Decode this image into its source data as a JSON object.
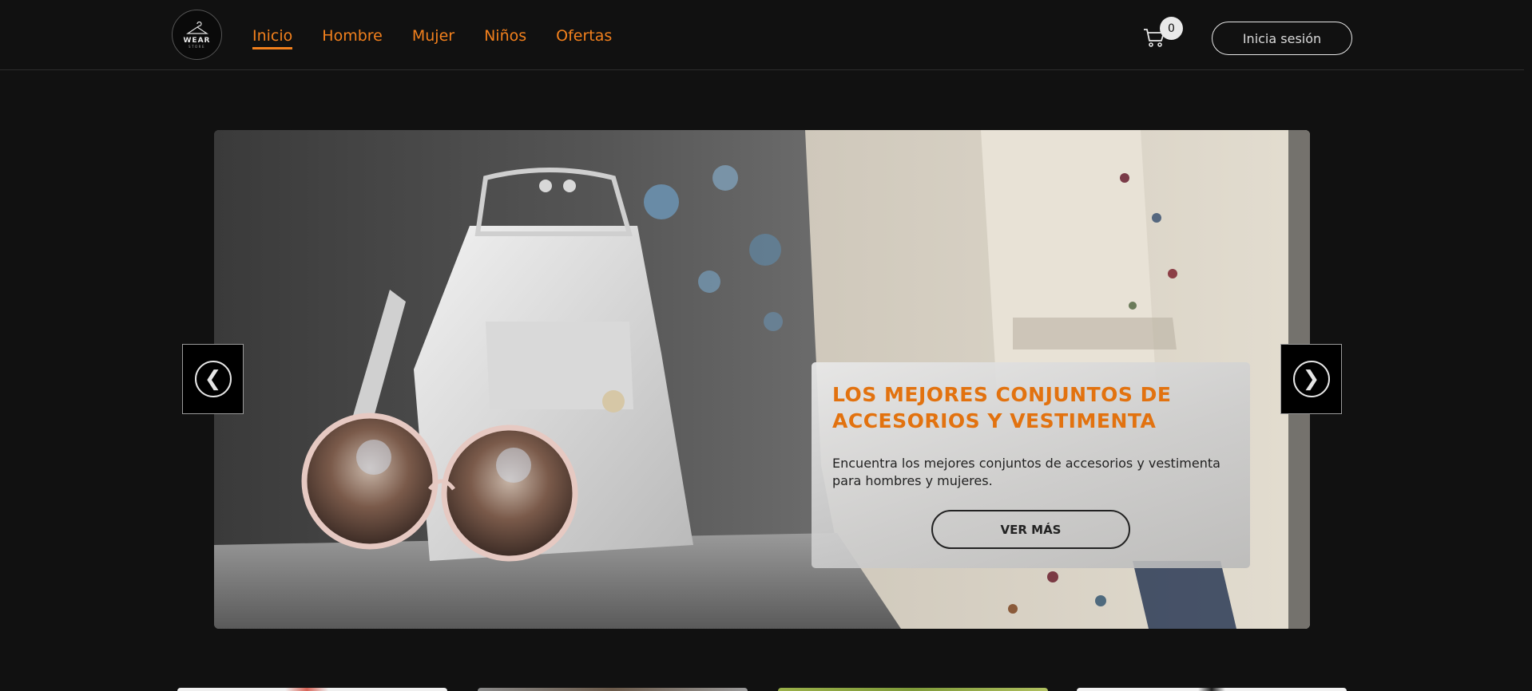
{
  "header": {
    "logo": {
      "word": "WEAR",
      "sub": "STORE"
    },
    "nav": [
      {
        "label": "Inicio",
        "active": true
      },
      {
        "label": "Hombre",
        "active": false
      },
      {
        "label": "Mujer",
        "active": false
      },
      {
        "label": "Niños",
        "active": false
      },
      {
        "label": "Ofertas",
        "active": false
      }
    ],
    "cart_count": "0",
    "login_label": "Inicia sesión"
  },
  "hero": {
    "title": "LOS MEJORES CONJUNTOS DE ACCESORIOS Y VESTIMENTA",
    "description": "Encuentra los mejores conjuntos de accesorios y vestimenta para hombres y mujeres.",
    "cta_label": "VER MÁS",
    "prev_icon": "chevron-left-icon",
    "next_icon": "chevron-right-icon",
    "prev_glyph": "❮",
    "next_glyph": "❯"
  },
  "colors": {
    "background": "#111111",
    "accent": "#f2801d",
    "hero_title": "#e2720f"
  }
}
